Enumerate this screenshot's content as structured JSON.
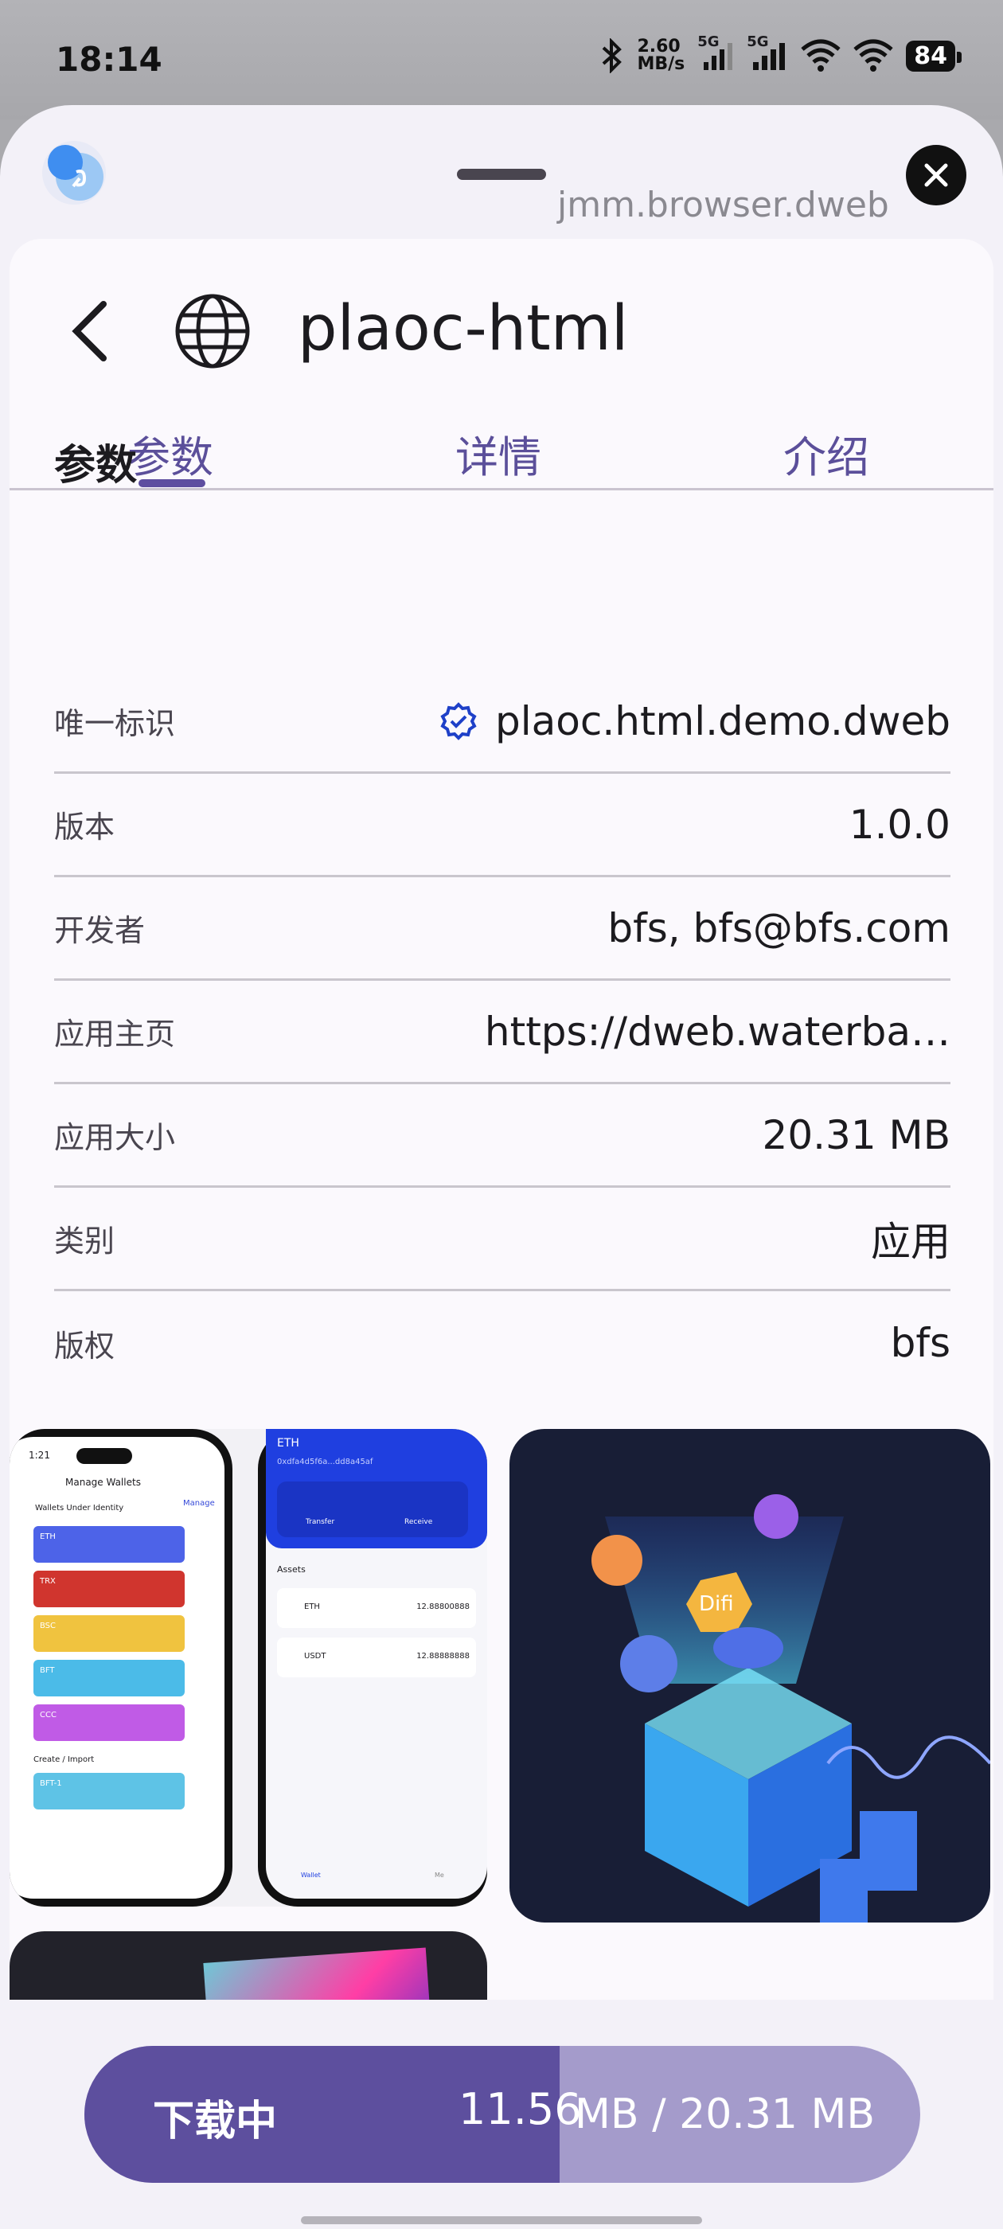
{
  "status_bar": {
    "time": "18:14",
    "net_speed_value": "2.60",
    "net_speed_unit": "MB/s",
    "signal_label": "5G",
    "battery": "84"
  },
  "sheet": {
    "host": "jmm.browser.dweb"
  },
  "app": {
    "title": "plaoc-html"
  },
  "tabs": [
    {
      "label": "参数",
      "active": true
    },
    {
      "label": "详情",
      "active": false
    },
    {
      "label": "介绍",
      "active": false
    }
  ],
  "section_title": "参数",
  "params": [
    {
      "label": "唯一标识",
      "value": "plaoc.html.demo.dweb",
      "verified": true
    },
    {
      "label": "版本",
      "value": "1.0.0"
    },
    {
      "label": "开发者",
      "value": "bfs, bfs@bfs.com"
    },
    {
      "label": "应用主页",
      "value": "https://dweb.waterba…"
    },
    {
      "label": "应用大小",
      "value": "20.31 MB"
    },
    {
      "label": "类别",
      "value": "应用"
    },
    {
      "label": "版权",
      "value": "bfs"
    }
  ],
  "screenshot1": {
    "time": "1:21",
    "title": "Manage Wallets",
    "subtitle": "Wallets Under Identity",
    "manage": "Manage",
    "wallets": [
      "ETH",
      "TRX",
      "BSC",
      "BFT",
      "CCC"
    ],
    "create_import": "Create / Import",
    "extra_wallet": "BFT-1",
    "eth_header": "ETH",
    "eth_address": "0xdfa4d5f6a...dd8a45af",
    "transfer": "Transfer",
    "receive": "Receive",
    "assets": "Assets",
    "asset_eth": "ETH",
    "asset_eth_value": "12.88800888",
    "asset_usdt": "USDT",
    "asset_usdt_value": "12.88888888",
    "nav_wallet": "Wallet",
    "nav_me": "Me"
  },
  "screenshot2": {
    "cube_label": "Difi"
  },
  "download": {
    "label": "下载中",
    "downloaded": "11.56",
    "total": "MB / 20.31 MB",
    "progress": 0.569
  },
  "colors": {
    "accent": "#5d4f9e",
    "accent_light": "#a49bcb",
    "verified": "#1e40c8"
  }
}
